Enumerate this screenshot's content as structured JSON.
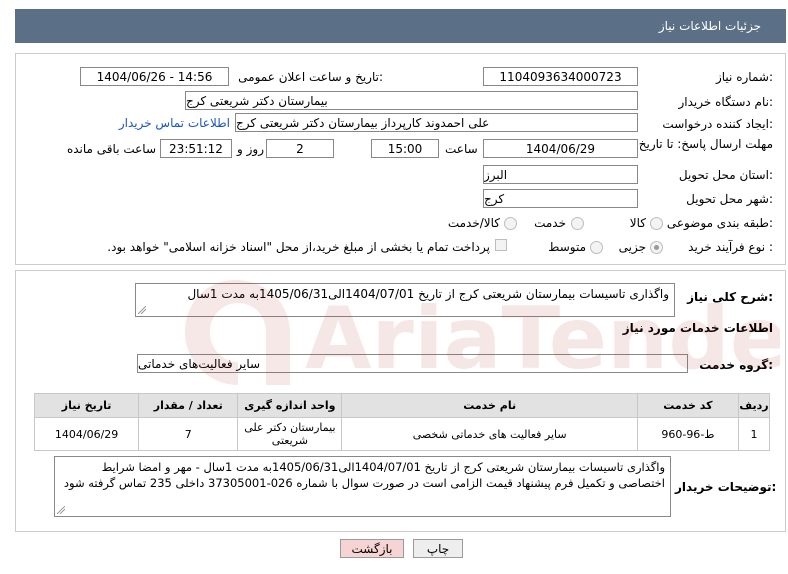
{
  "header": {
    "title": "جزئیات اطلاعات نیاز"
  },
  "fields": {
    "need_number_label": "شماره نیاز:",
    "need_number": "1104093634000723",
    "announce_label": "تاریخ و ساعت اعلان عمومی:",
    "announce_value": "1404/06/26 - 14:56",
    "buyer_org_label": "نام دستگاه خریدار:",
    "buyer_org": "بیمارستان دکتر شریعتی کرج",
    "creator_label": "ایجاد کننده درخواست:",
    "creator": "علی احمدوند کارپرداز بیمارستان دکتر شریعتی کرج",
    "contact_link": "اطلاعات تماس خریدار",
    "deadline_label": "مهلت ارسال پاسخ: تا تاریخ:",
    "deadline_date": "1404/06/29",
    "time_label": "ساعت",
    "deadline_time": "15:00",
    "days_value": "2",
    "days_label": "روز و",
    "remaining_time": "23:51:12",
    "remaining_label": "ساعت باقی مانده",
    "province_label": "استان محل تحویل:",
    "province": "البرز",
    "city_label": "شهر محل تحویل:",
    "city": "کرج",
    "category_label": "طبقه بندی موضوعی:",
    "category_options": [
      "کالا",
      "خدمت",
      "کالا/خدمت"
    ],
    "process_label": "نوع فرآیند خرید :",
    "process_options": [
      "جزیی",
      "متوسط"
    ],
    "payment_note": "پرداخت تمام یا بخشی از مبلغ خرید،از محل \"اسناد خزانه اسلامی\" خواهد بود."
  },
  "summary": {
    "label": "شرح کلی نیاز:",
    "text": "واگذاری تاسیسات بیمارستان شریعتی کرج از تاریخ 1404/07/01الی1405/06/31به مدت 1سال"
  },
  "services": {
    "section_title": "اطلاعات خدمات مورد نیاز",
    "group_label": "گروه خدمت:",
    "group_value": "سایر فعالیت‌های خدماتی",
    "columns": [
      "ردیف",
      "کد خدمت",
      "نام خدمت",
      "واحد اندازه گیری",
      "تعداد / مقدار",
      "تاریخ نیاز"
    ],
    "rows": [
      [
        "1",
        "ط-96-960",
        "سایر فعالیت های خدماتی شخصی",
        "بیمارستان دکتر علی شریعتی",
        "7",
        "1404/06/29"
      ]
    ]
  },
  "buyer_notes": {
    "label": "توضیحات خریدار:",
    "line1": "واگذاری تاسیسات بیمارستان شریعتی کرج از تاریخ 1404/07/01الی1405/06/31به مدت 1سال - مهر و امضا شرایط",
    "line2": "اختصاصی و تکمیل فرم پیشنهاد قیمت الزامی است در صورت سوال با شماره 026-37305001 داخلی 235 تماس گرفته شود"
  },
  "buttons": {
    "print": "چاپ",
    "back": "بازگشت"
  },
  "watermark": {
    "text": "AriaTender.net"
  },
  "colors": {
    "header_bg": "#5b6f86",
    "link": "#1a54c8",
    "back_bg": "#f7d4d4"
  }
}
